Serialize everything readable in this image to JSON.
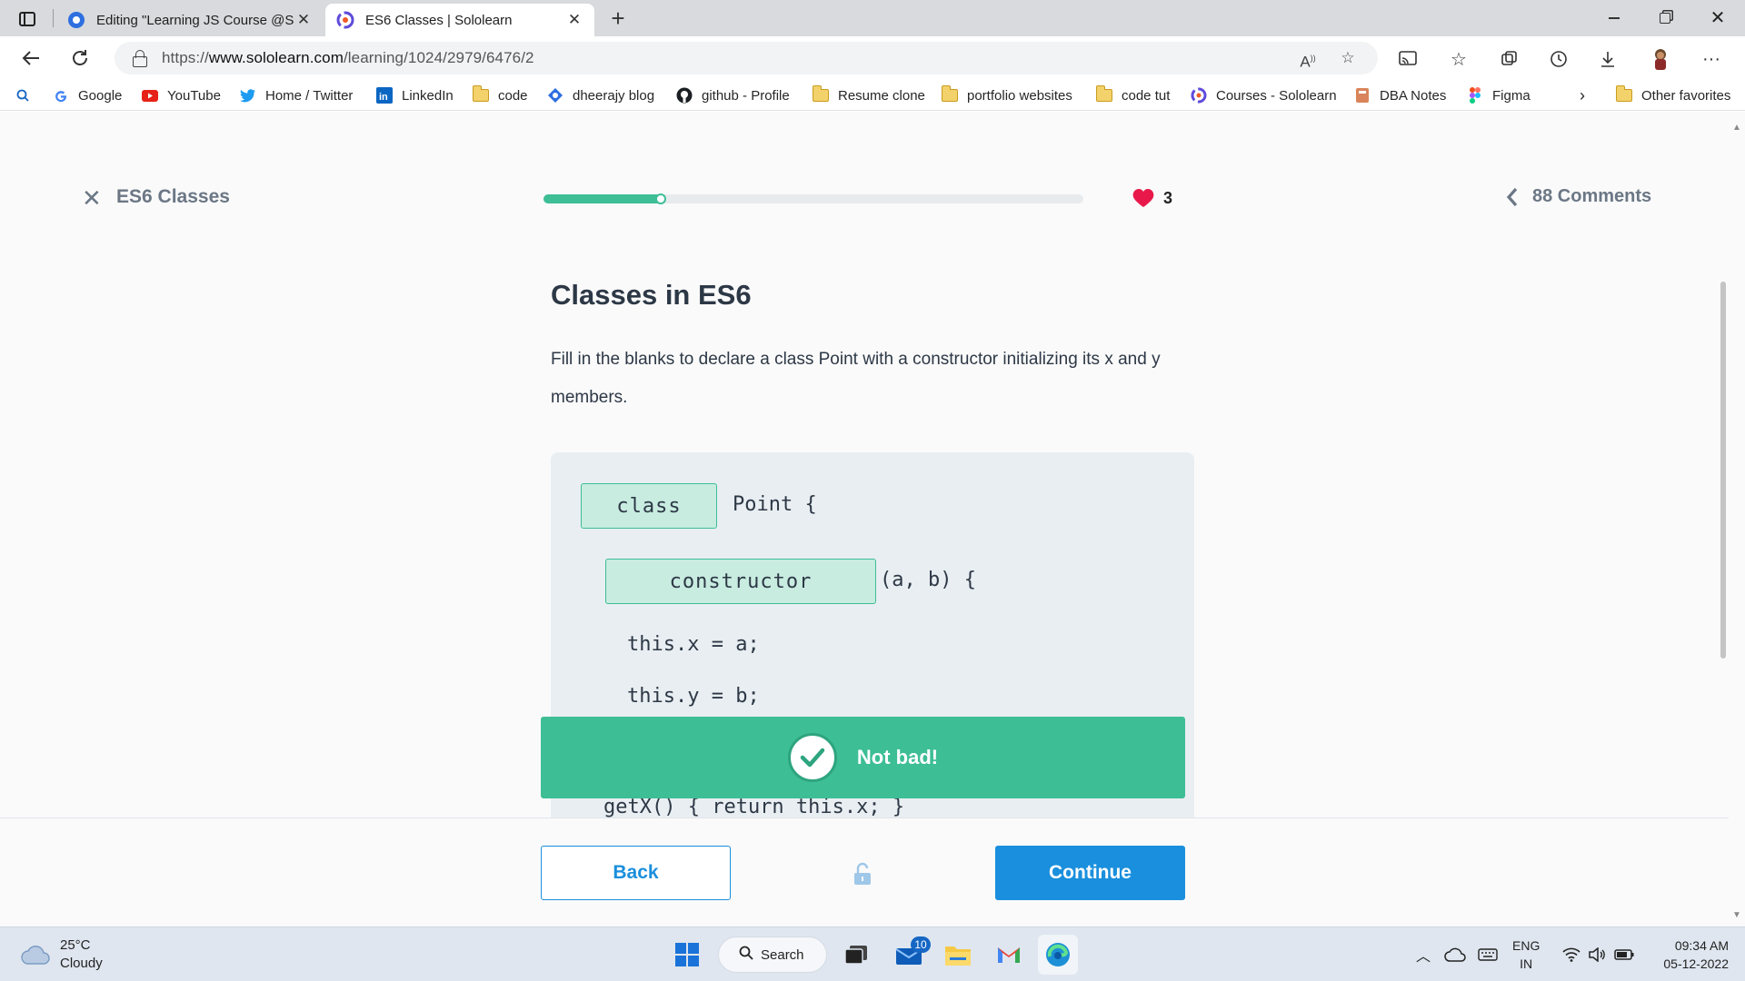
{
  "browser": {
    "tabs": [
      {
        "label": "Editing \"Learning JS Course @Sc",
        "active": false
      },
      {
        "label": "ES6 Classes | Sololearn",
        "active": true
      }
    ],
    "url_scheme": "https://",
    "url_host": "www.sololearn.com",
    "url_path": "/learning/1024/2979/6476/2",
    "favorites": [
      {
        "label": "Google",
        "icon": "google-icon"
      },
      {
        "label": "YouTube",
        "icon": "youtube-icon"
      },
      {
        "label": "Home / Twitter",
        "icon": "twitter-icon"
      },
      {
        "label": "LinkedIn",
        "icon": "linkedin-icon"
      },
      {
        "label": "code",
        "icon": "folder-icon"
      },
      {
        "label": "dheerajy blog",
        "icon": "blog-icon"
      },
      {
        "label": "github - Profile",
        "icon": "github-icon"
      },
      {
        "label": "Resume clone",
        "icon": "folder-icon"
      },
      {
        "label": "portfolio websites",
        "icon": "folder-icon"
      },
      {
        "label": "code tut",
        "icon": "folder-icon"
      },
      {
        "label": "Courses - Sololearn",
        "icon": "sololearn-icon"
      },
      {
        "label": "DBA Notes",
        "icon": "notebook-icon"
      },
      {
        "label": "Figma",
        "icon": "figma-icon"
      }
    ],
    "other_favorites": "Other favorites"
  },
  "lesson": {
    "title": "ES6 Classes",
    "progress": 0.22,
    "hearts": "3",
    "comments": "88 Comments"
  },
  "question": {
    "title": "Classes in ES6",
    "text": "Fill in the blanks to declare a class Point with a constructor initializing its x and y members.",
    "code": {
      "blank1": "class",
      "line1_rest": "Point {",
      "blank2": "constructor",
      "line2_rest": "(a, b) {",
      "line3": "this.x = a;",
      "line4": "this.y = b;",
      "line5_partial": "getX() { return this.x; }"
    }
  },
  "feedback": {
    "message": "Not bad!"
  },
  "footer": {
    "back": "Back",
    "continue": "Continue"
  },
  "taskbar": {
    "temperature": "25°C",
    "condition": "Cloudy",
    "search": "Search",
    "mail_badge": "10",
    "lang_line1": "ENG",
    "lang_line2": "IN",
    "time": "09:34 AM",
    "date": "05-12-2022"
  },
  "colors": {
    "accent_green": "#3dbe95",
    "accent_blue": "#1a8fdd",
    "heart_red": "#e8194a",
    "muted_text": "#6b7785"
  }
}
